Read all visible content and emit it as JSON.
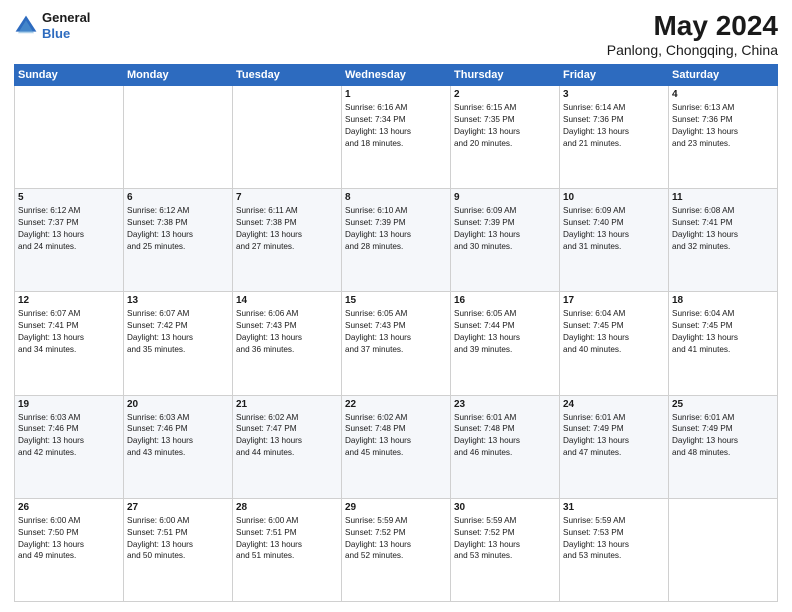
{
  "header": {
    "logo_general": "General",
    "logo_blue": "Blue",
    "month_title": "May 2024",
    "location": "Panlong, Chongqing, China"
  },
  "weekdays": [
    "Sunday",
    "Monday",
    "Tuesday",
    "Wednesday",
    "Thursday",
    "Friday",
    "Saturday"
  ],
  "weeks": [
    [
      {
        "day": "",
        "info": ""
      },
      {
        "day": "",
        "info": ""
      },
      {
        "day": "",
        "info": ""
      },
      {
        "day": "1",
        "info": "Sunrise: 6:16 AM\nSunset: 7:34 PM\nDaylight: 13 hours\nand 18 minutes."
      },
      {
        "day": "2",
        "info": "Sunrise: 6:15 AM\nSunset: 7:35 PM\nDaylight: 13 hours\nand 20 minutes."
      },
      {
        "day": "3",
        "info": "Sunrise: 6:14 AM\nSunset: 7:36 PM\nDaylight: 13 hours\nand 21 minutes."
      },
      {
        "day": "4",
        "info": "Sunrise: 6:13 AM\nSunset: 7:36 PM\nDaylight: 13 hours\nand 23 minutes."
      }
    ],
    [
      {
        "day": "5",
        "info": "Sunrise: 6:12 AM\nSunset: 7:37 PM\nDaylight: 13 hours\nand 24 minutes."
      },
      {
        "day": "6",
        "info": "Sunrise: 6:12 AM\nSunset: 7:38 PM\nDaylight: 13 hours\nand 25 minutes."
      },
      {
        "day": "7",
        "info": "Sunrise: 6:11 AM\nSunset: 7:38 PM\nDaylight: 13 hours\nand 27 minutes."
      },
      {
        "day": "8",
        "info": "Sunrise: 6:10 AM\nSunset: 7:39 PM\nDaylight: 13 hours\nand 28 minutes."
      },
      {
        "day": "9",
        "info": "Sunrise: 6:09 AM\nSunset: 7:39 PM\nDaylight: 13 hours\nand 30 minutes."
      },
      {
        "day": "10",
        "info": "Sunrise: 6:09 AM\nSunset: 7:40 PM\nDaylight: 13 hours\nand 31 minutes."
      },
      {
        "day": "11",
        "info": "Sunrise: 6:08 AM\nSunset: 7:41 PM\nDaylight: 13 hours\nand 32 minutes."
      }
    ],
    [
      {
        "day": "12",
        "info": "Sunrise: 6:07 AM\nSunset: 7:41 PM\nDaylight: 13 hours\nand 34 minutes."
      },
      {
        "day": "13",
        "info": "Sunrise: 6:07 AM\nSunset: 7:42 PM\nDaylight: 13 hours\nand 35 minutes."
      },
      {
        "day": "14",
        "info": "Sunrise: 6:06 AM\nSunset: 7:43 PM\nDaylight: 13 hours\nand 36 minutes."
      },
      {
        "day": "15",
        "info": "Sunrise: 6:05 AM\nSunset: 7:43 PM\nDaylight: 13 hours\nand 37 minutes."
      },
      {
        "day": "16",
        "info": "Sunrise: 6:05 AM\nSunset: 7:44 PM\nDaylight: 13 hours\nand 39 minutes."
      },
      {
        "day": "17",
        "info": "Sunrise: 6:04 AM\nSunset: 7:45 PM\nDaylight: 13 hours\nand 40 minutes."
      },
      {
        "day": "18",
        "info": "Sunrise: 6:04 AM\nSunset: 7:45 PM\nDaylight: 13 hours\nand 41 minutes."
      }
    ],
    [
      {
        "day": "19",
        "info": "Sunrise: 6:03 AM\nSunset: 7:46 PM\nDaylight: 13 hours\nand 42 minutes."
      },
      {
        "day": "20",
        "info": "Sunrise: 6:03 AM\nSunset: 7:46 PM\nDaylight: 13 hours\nand 43 minutes."
      },
      {
        "day": "21",
        "info": "Sunrise: 6:02 AM\nSunset: 7:47 PM\nDaylight: 13 hours\nand 44 minutes."
      },
      {
        "day": "22",
        "info": "Sunrise: 6:02 AM\nSunset: 7:48 PM\nDaylight: 13 hours\nand 45 minutes."
      },
      {
        "day": "23",
        "info": "Sunrise: 6:01 AM\nSunset: 7:48 PM\nDaylight: 13 hours\nand 46 minutes."
      },
      {
        "day": "24",
        "info": "Sunrise: 6:01 AM\nSunset: 7:49 PM\nDaylight: 13 hours\nand 47 minutes."
      },
      {
        "day": "25",
        "info": "Sunrise: 6:01 AM\nSunset: 7:49 PM\nDaylight: 13 hours\nand 48 minutes."
      }
    ],
    [
      {
        "day": "26",
        "info": "Sunrise: 6:00 AM\nSunset: 7:50 PM\nDaylight: 13 hours\nand 49 minutes."
      },
      {
        "day": "27",
        "info": "Sunrise: 6:00 AM\nSunset: 7:51 PM\nDaylight: 13 hours\nand 50 minutes."
      },
      {
        "day": "28",
        "info": "Sunrise: 6:00 AM\nSunset: 7:51 PM\nDaylight: 13 hours\nand 51 minutes."
      },
      {
        "day": "29",
        "info": "Sunrise: 5:59 AM\nSunset: 7:52 PM\nDaylight: 13 hours\nand 52 minutes."
      },
      {
        "day": "30",
        "info": "Sunrise: 5:59 AM\nSunset: 7:52 PM\nDaylight: 13 hours\nand 53 minutes."
      },
      {
        "day": "31",
        "info": "Sunrise: 5:59 AM\nSunset: 7:53 PM\nDaylight: 13 hours\nand 53 minutes."
      },
      {
        "day": "",
        "info": ""
      }
    ]
  ]
}
